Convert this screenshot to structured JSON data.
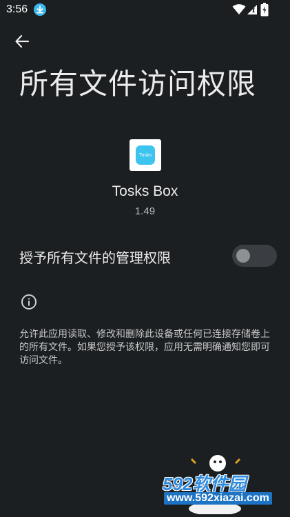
{
  "status_bar": {
    "time": "3:56",
    "icons": [
      "download-icon",
      "wifi-icon",
      "signal-icon",
      "battery-icon"
    ]
  },
  "header": {
    "back_icon": "arrow-back-icon",
    "title": "所有文件访问权限"
  },
  "app": {
    "icon_label": "Tosks",
    "name": "Tosks Box",
    "version": "1.49",
    "icon_color": "#3cc3ee"
  },
  "permission": {
    "label": "授予所有文件的管理权限",
    "toggle_on": false
  },
  "info": {
    "icon": "info-icon",
    "description": "允许此应用读取、修改和删除此设备或任何已连接存储卷上的所有文件。如果您授予该权限，应用无需明确通知您即可访问文件。"
  },
  "watermark": {
    "brand": "592软件园",
    "url": "www.592xiazai.com"
  },
  "colors": {
    "background": "#1c1f21",
    "accent": "#3cc3ee",
    "watermark_blue": "#2e8ce0"
  }
}
